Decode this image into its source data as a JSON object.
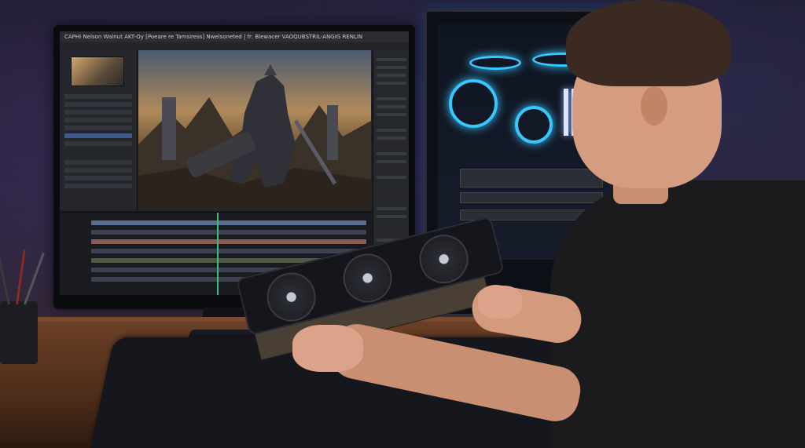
{
  "screen": {
    "title_bar_text": "CAPHI Nelson Walnut AKT-Oy [Poeare re Tamsiress] Nwelsoneted | fr: Blewacer VAOQUBSTRIL-ANGIG RENLIN"
  },
  "colors": {
    "case_accent": "#38c6ff",
    "timeline_playhead": "#3fbf7a",
    "desk": "#6a3f26"
  }
}
